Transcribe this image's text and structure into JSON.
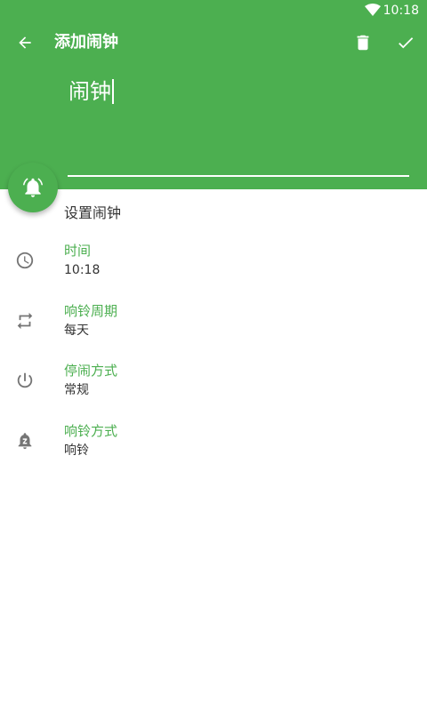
{
  "status_bar": {
    "time": "10:18"
  },
  "toolbar": {
    "title": "添加闹钟"
  },
  "alarm_name": {
    "value": "闹钟"
  },
  "section": {
    "title": "设置闹钟"
  },
  "settings": [
    {
      "label": "时间",
      "value": "10:18",
      "icon": "clock-icon"
    },
    {
      "label": "响铃周期",
      "value": "每天",
      "icon": "repeat-icon"
    },
    {
      "label": "停闹方式",
      "value": "常规",
      "icon": "power-icon"
    },
    {
      "label": "响铃方式",
      "value": "响铃",
      "icon": "alarm-snooze-icon"
    }
  ],
  "colors": {
    "accent": "#4caf50",
    "text": "#333333",
    "icon": "#757575"
  }
}
